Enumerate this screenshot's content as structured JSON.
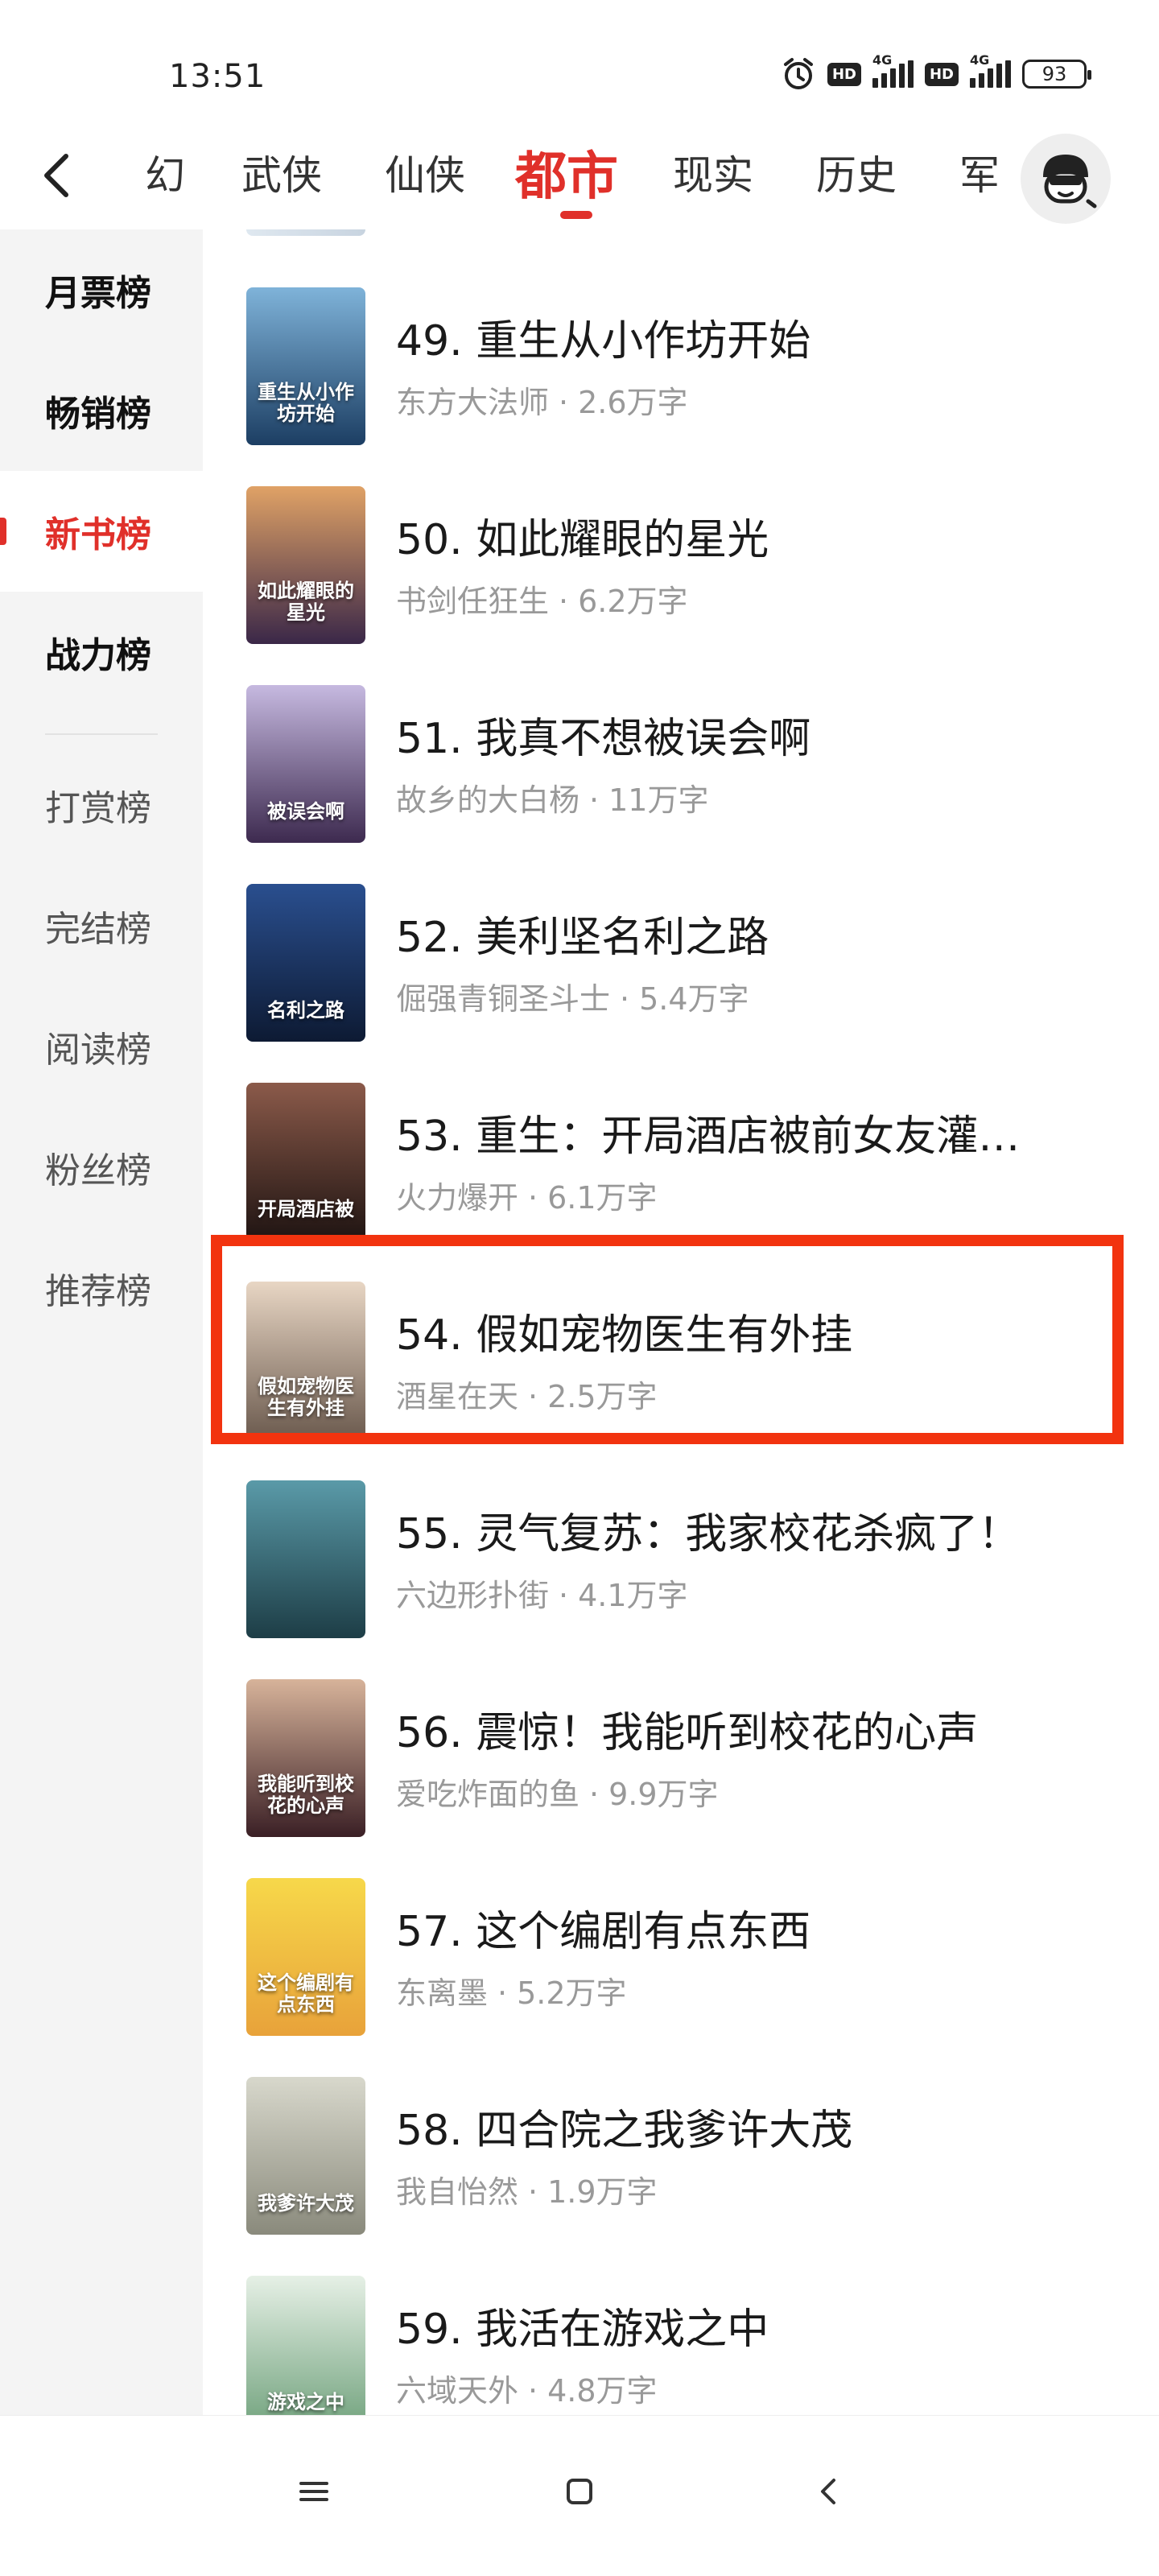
{
  "status_bar": {
    "time": "13:51",
    "battery": "93",
    "hd": "HD",
    "network": "4G"
  },
  "top_nav": {
    "tabs": [
      "幻",
      "武侠",
      "仙侠",
      "都市",
      "现实",
      "历史",
      "军"
    ],
    "active_tab": "都市"
  },
  "sidebar": {
    "items": [
      "月票榜",
      "畅销榜",
      "新书榜",
      "战力榜",
      "打赏榜",
      "完结榜",
      "阅读榜",
      "粉丝榜",
      "推荐榜"
    ],
    "selected": "新书榜"
  },
  "books": [
    {
      "rank_title": "49. 重生从小作坊开始",
      "author": "东方大法师",
      "words": "2.6万字",
      "cover_text": "重生从小作坊开始",
      "cover_color_top": "#7fb3d9",
      "cover_color_bottom": "#1c3e63"
    },
    {
      "rank_title": "50. 如此耀眼的星光",
      "author": "书剑任狂生",
      "words": "6.2万字",
      "cover_text": "如此耀眼的星光",
      "cover_color_top": "#e0a266",
      "cover_color_bottom": "#3a2748"
    },
    {
      "rank_title": "51. 我真不想被误会啊",
      "author": "故乡的大白杨",
      "words": "11万字",
      "cover_text": "被误会啊",
      "cover_color_top": "#c6b9e0",
      "cover_color_bottom": "#3d2a4f"
    },
    {
      "rank_title": "52. 美利坚名利之路",
      "author": "倔强青铜圣斗士",
      "words": "5.4万字",
      "cover_text": "名利之路",
      "cover_color_top": "#2a4f8f",
      "cover_color_bottom": "#0d1a33"
    },
    {
      "rank_title": "53. 重生：开局酒店被前女友灌…",
      "author": "火力爆开",
      "words": "6.1万字",
      "cover_text": "开局酒店被",
      "cover_color_top": "#8b5a4a",
      "cover_color_bottom": "#1f1412"
    },
    {
      "rank_title": "54. 假如宠物医生有外挂",
      "author": "酒星在天",
      "words": "2.5万字",
      "cover_text": "假如宠物医生有外挂",
      "cover_color_top": "#e8d6c4",
      "cover_color_bottom": "#6b5a4e"
    },
    {
      "rank_title": "55. 灵气复苏：我家校花杀疯了！",
      "author": "六边形扑街",
      "words": "4.1万字",
      "cover_text": "",
      "cover_color_top": "#5a9aa8",
      "cover_color_bottom": "#1d3d46"
    },
    {
      "rank_title": "56. 震惊！我能听到校花的心声",
      "author": "爱吃炸面的鱼",
      "words": "9.9万字",
      "cover_text": "我能听到校花的心声",
      "cover_color_top": "#d7b39a",
      "cover_color_bottom": "#3a1f25"
    },
    {
      "rank_title": "57. 这个编剧有点东西",
      "author": "东离墨",
      "words": "5.2万字",
      "cover_text": "这个编剧有点东西",
      "cover_color_top": "#f7d84a",
      "cover_color_bottom": "#e8a23a"
    },
    {
      "rank_title": "58. 四合院之我爹许大茂",
      "author": "我自怡然",
      "words": "1.9万字",
      "cover_text": "我爹许大茂",
      "cover_color_top": "#d8d8cc",
      "cover_color_bottom": "#8a8a7c"
    },
    {
      "rank_title": "59. 我活在游戏之中",
      "author": "六域天外",
      "words": "4.8万字",
      "cover_text": "游戏之中",
      "cover_color_top": "#e6f0e6",
      "cover_color_bottom": "#6ea07a"
    }
  ],
  "icons": {
    "back": "chevron-left-icon",
    "avatar": "user-avatar-icon",
    "nav_menu": "menu-icon",
    "nav_home": "home-square-icon",
    "nav_back": "back-arrow-icon"
  },
  "colors": {
    "accent": "#e0302a",
    "highlight": "#f2330f"
  }
}
